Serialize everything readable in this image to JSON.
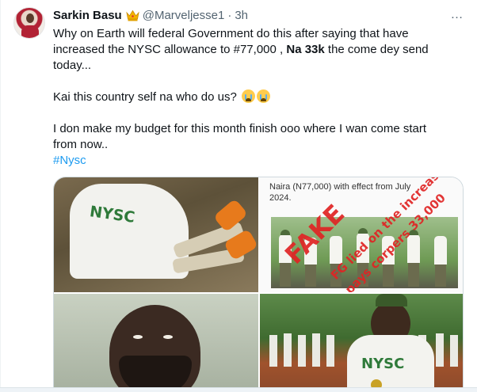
{
  "tweet": {
    "display_name": "Sarkin Basu",
    "handle": "@Marveljesse1",
    "separator": "·",
    "time": "3h",
    "more_icon": "…",
    "text": {
      "line1_part1": "Why on Earth will federal Government do this after saying that have increased the NYSC allowance to #77,000 , ",
      "line1_bold": "Na 33k",
      "line1_part2": " the come dey send today...",
      "line2": "Kai this country self na who do us?",
      "line3": "I don make my budget for this month finish ooo where I wan come start from now..",
      "hashtag": "#Nysc"
    },
    "icons": {
      "verified_badge": "crown-badge-icon",
      "emoji": "crying-face-emoji"
    }
  },
  "media": {
    "tile1": {
      "shirt_text": "NYSC"
    },
    "tile2": {
      "caption_line1": "Naira (N77,000) with effect from July",
      "caption_line2": "2024.",
      "stamp_big": "FAKE",
      "stamp_line1": "FG lied on the increase",
      "stamp_line2": "pays corpers 33,000"
    },
    "tile4": {
      "shirt_text": "NYSC"
    }
  },
  "colors": {
    "text": "#0f1419",
    "secondary": "#536471",
    "link": "#1d9bf0",
    "border": "#cfd9de",
    "stamp_red": "#e02424",
    "nysc_green": "#2f7a3a"
  }
}
